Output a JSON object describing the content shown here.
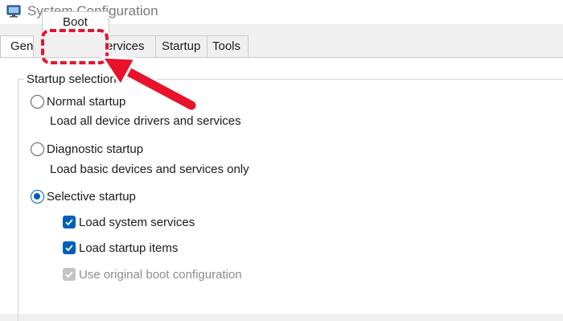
{
  "window": {
    "title": "System Configuration"
  },
  "tabs": [
    {
      "label": "General",
      "visible_text": "Gener"
    },
    {
      "label": "Boot"
    },
    {
      "label": "Services",
      "visible_text": "ervices"
    },
    {
      "label": "Startup"
    },
    {
      "label": "Tools"
    }
  ],
  "startup_selection": {
    "heading": "Startup selection",
    "options": [
      {
        "label": "Normal startup",
        "description": "Load all device drivers and services",
        "selected": false
      },
      {
        "label": "Diagnostic startup",
        "description": "Load basic devices and services only",
        "selected": false
      },
      {
        "label": "Selective startup",
        "selected": true
      }
    ],
    "checkboxes": [
      {
        "label": "Load system services",
        "checked": true,
        "enabled": true
      },
      {
        "label": "Load startup items",
        "checked": true,
        "enabled": true
      },
      {
        "label": "Use original boot configuration",
        "checked": true,
        "enabled": false
      }
    ]
  },
  "annotation": {
    "color": "#e8132b",
    "target": "Boot"
  },
  "colors": {
    "accent": "#005fb8",
    "disabled": "#c4c4c4"
  }
}
